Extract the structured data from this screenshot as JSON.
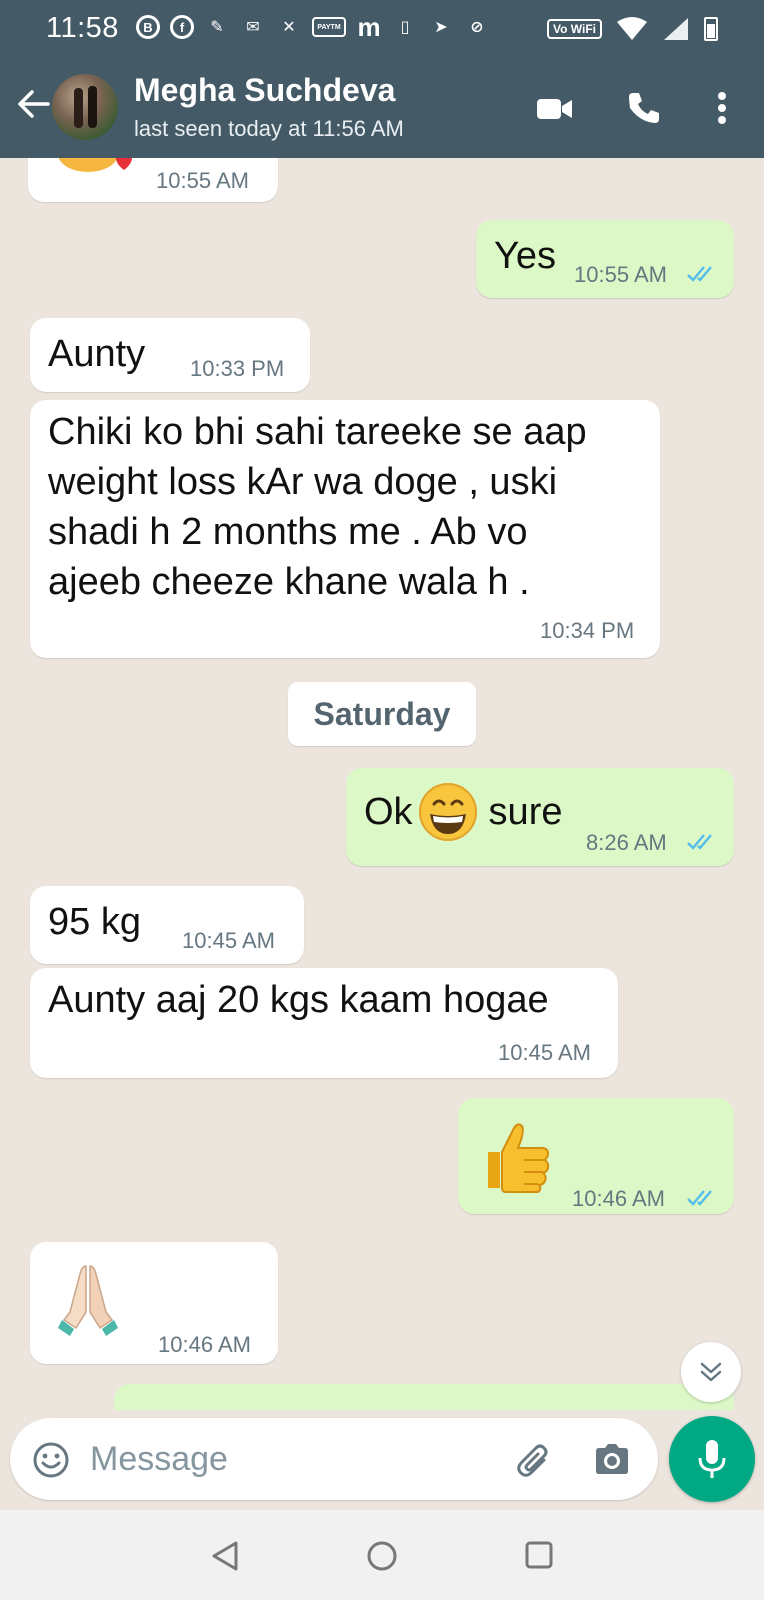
{
  "status_bar": {
    "time": "11:58",
    "network_label": "Vo WiFi"
  },
  "header": {
    "contact_name": "Megha Suchdeva",
    "last_seen": "last seen today at 11:56 AM"
  },
  "messages": [
    {
      "direction": "in",
      "text": "",
      "time": "10:55 AM",
      "partial": true
    },
    {
      "direction": "out",
      "text": "Yes",
      "time": "10:55 AM",
      "read": true
    },
    {
      "direction": "in",
      "text": "Aunty",
      "time": "10:33 PM"
    },
    {
      "direction": "in",
      "lines": [
        "Chiki ko bhi sahi tareeke se aap",
        "weight loss kAr  wa doge , uski",
        "shadi h 2 months me . Ab vo",
        "ajeeb cheeze khane wala h ."
      ],
      "time": "10:34 PM"
    },
    {
      "direction": "out",
      "text_before": "Ok",
      "emoji": "grinning-face-emoji",
      "text_after": " sure",
      "time": "8:26 AM",
      "read": true
    },
    {
      "direction": "in",
      "text": "95 kg",
      "time": "10:45 AM"
    },
    {
      "direction": "in",
      "text": "Aunty aaj 20 kgs kaam hogae",
      "time": "10:45 AM"
    },
    {
      "direction": "out",
      "emoji": "thumbs-up-emoji",
      "time": "10:46 AM",
      "read": true
    },
    {
      "direction": "in",
      "emoji": "folded-hands-emoji",
      "time": "10:46 AM"
    }
  ],
  "date_divider": "Saturday",
  "composer": {
    "placeholder": "Message"
  },
  "colors": {
    "header_bg": "#445a66",
    "chat_bg": "#ece5dd",
    "incoming_bubble": "#ffffff",
    "outgoing_bubble": "#dcf8c6",
    "read_tick": "#53bdeb",
    "mic_button": "#00a884"
  }
}
